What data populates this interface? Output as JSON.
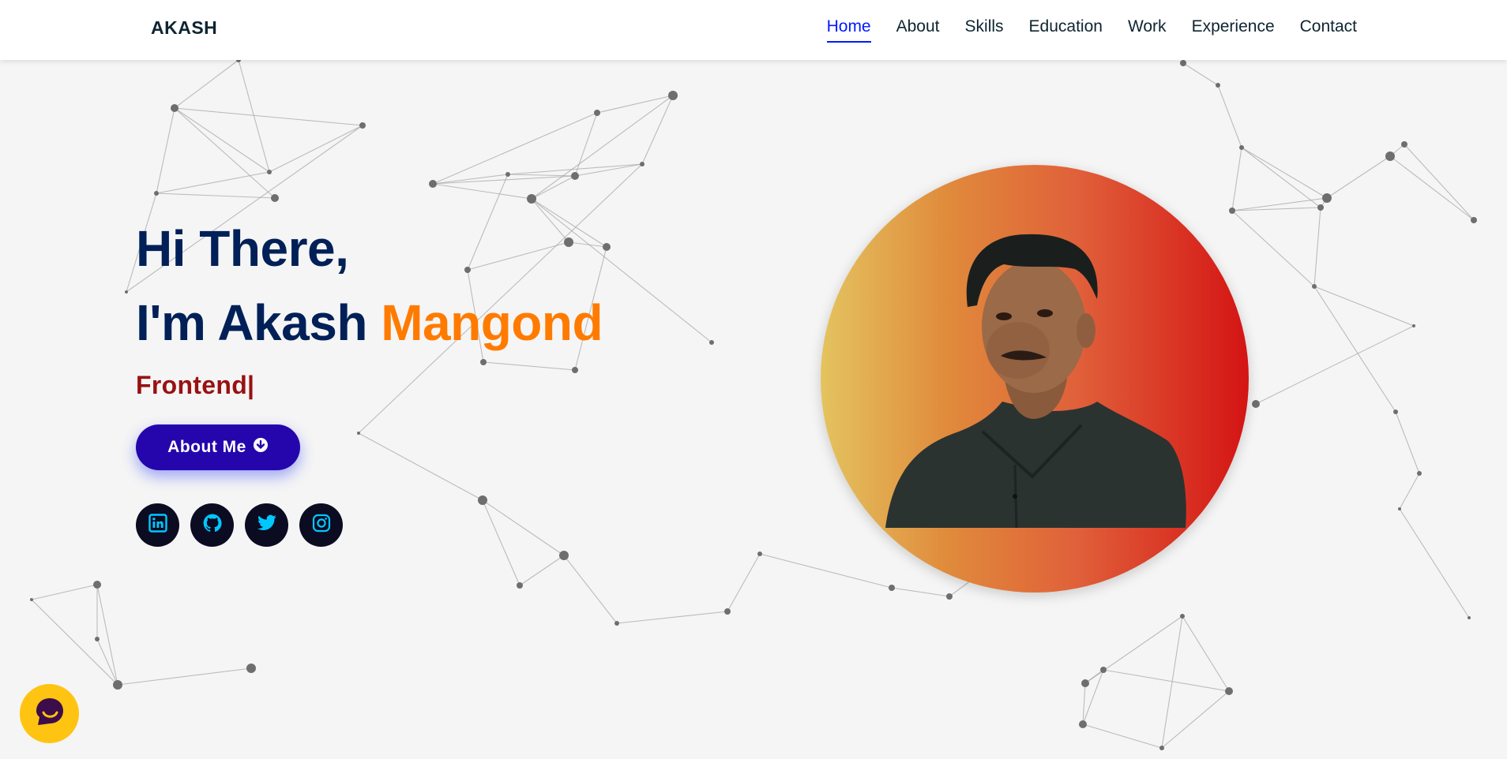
{
  "header": {
    "brand": "AKASH",
    "nav": [
      {
        "label": "Home",
        "active": true
      },
      {
        "label": "About",
        "active": false
      },
      {
        "label": "Skills",
        "active": false
      },
      {
        "label": "Education",
        "active": false
      },
      {
        "label": "Work",
        "active": false
      },
      {
        "label": "Experience",
        "active": false
      },
      {
        "label": "Contact",
        "active": false
      }
    ]
  },
  "hero": {
    "greeting": "Hi There,",
    "intro_prefix": "I'm Akash ",
    "intro_accent": "Mangond",
    "typed_text": "Frontend|",
    "cta_label": "About Me",
    "cta_icon": "arrow-down-circle-icon",
    "socials": [
      {
        "name": "linkedin-icon"
      },
      {
        "name": "github-icon"
      },
      {
        "name": "twitter-icon"
      },
      {
        "name": "instagram-icon"
      }
    ],
    "photo": "profile-photo"
  },
  "chat_widget": {
    "icon": "chat-smile-icon"
  },
  "colors": {
    "heading": "#002057",
    "accent": "#ff7b00",
    "typed": "#991111",
    "button": "#2506ad",
    "nav_active": "#011aff",
    "social_icon": "#00c8ff",
    "chat_bg": "#ffc312"
  }
}
